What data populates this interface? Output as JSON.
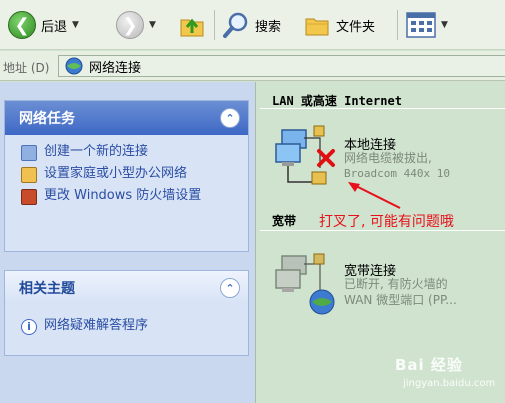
{
  "toolbar": {
    "back_label": "后退",
    "search_label": "搜索",
    "folders_label": "文件夹"
  },
  "address": {
    "label": "地址 (D)",
    "value": "网络连接"
  },
  "network_tasks": {
    "title": "网络任务",
    "items": [
      {
        "label": "创建一个新的连接",
        "icon": "new-connection-icon"
      },
      {
        "label": "设置家庭或小型办公网络",
        "icon": "home-network-icon"
      },
      {
        "label": "更改 Windows 防火墙设置",
        "icon": "firewall-icon"
      }
    ]
  },
  "related_topics": {
    "title": "相关主题",
    "items": [
      {
        "label": "网络疑难解答程序",
        "icon": "info-icon"
      }
    ]
  },
  "lan_group": {
    "title": "LAN 或高速 Internet",
    "connection": {
      "name": "本地连接",
      "status": "网络电缆被拔出,",
      "device": "Broadcom 440x 10"
    }
  },
  "broadband_group": {
    "title": "宽带",
    "connection": {
      "name": "宽带连接",
      "status": "已断开, 有防火墙的",
      "device": "WAN 微型端口 (PP..."
    }
  },
  "annotation": "打叉了, 可能有问题哦",
  "watermark": {
    "brand": "Bai 经验",
    "sub": "jingyan.baidu.com"
  },
  "colors": {
    "annotation": "#e8101a",
    "task_header": "#3e68c5",
    "content_bg": "#cfe3cf"
  }
}
